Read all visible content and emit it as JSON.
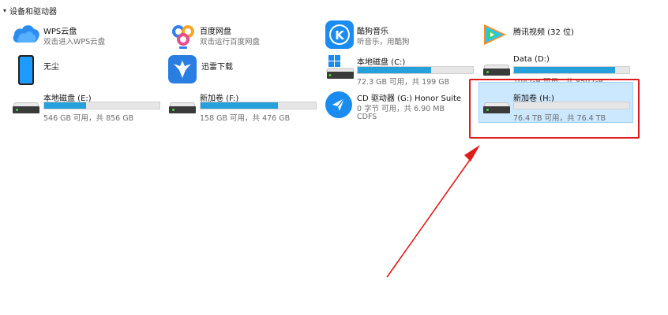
{
  "section": {
    "title": "设备和驱动器"
  },
  "items": [
    {
      "name": "WPS云盘",
      "sub": "双击进入WPS云盘",
      "icon": "wps-cloud-icon"
    },
    {
      "name": "百度网盘",
      "sub": "双击运行百度网盘",
      "icon": "baidu-netdisk-icon"
    },
    {
      "name": "酷狗音乐",
      "sub": "听音乐，用酷狗",
      "icon": "kugou-music-icon"
    },
    {
      "name": "腾讯视频 (32 位)",
      "icon": "tencent-video-icon"
    },
    {
      "name": "无尘",
      "icon": "phone-icon"
    },
    {
      "name": "迅雷下载",
      "icon": "xunlei-download-icon"
    },
    {
      "name": "本地磁盘 (C:)",
      "sub": "72.3 GB 可用，共 199 GB",
      "usage": 0.64,
      "icon": "windows-drive-icon"
    },
    {
      "name": "Data (D:)",
      "sub": "104 GB 可用，共 850 GB",
      "usage": 0.88,
      "icon": "drive-icon"
    },
    {
      "name": "本地磁盘 (E:)",
      "sub": "546 GB 可用，共 856 GB",
      "usage": 0.36,
      "icon": "drive-icon"
    },
    {
      "name": "新加卷 (F:)",
      "sub": "158 GB 可用，共 476 GB",
      "usage": 0.67,
      "icon": "drive-icon"
    },
    {
      "name": "CD 驱动器 (G:) Honor Suite",
      "sub": "0 字节 可用，共 6.90 MB",
      "sub2": "CDFS",
      "icon": "honor-cd-icon"
    },
    {
      "name": "新加卷 (H:)",
      "sub": "76.4 TB 可用，共 76.4 TB",
      "usage": 0.0,
      "icon": "drive-icon"
    }
  ],
  "colors": {
    "bar_fill": "#26a0da",
    "highlight": "#e01b1b",
    "selection": "#cce8ff"
  }
}
